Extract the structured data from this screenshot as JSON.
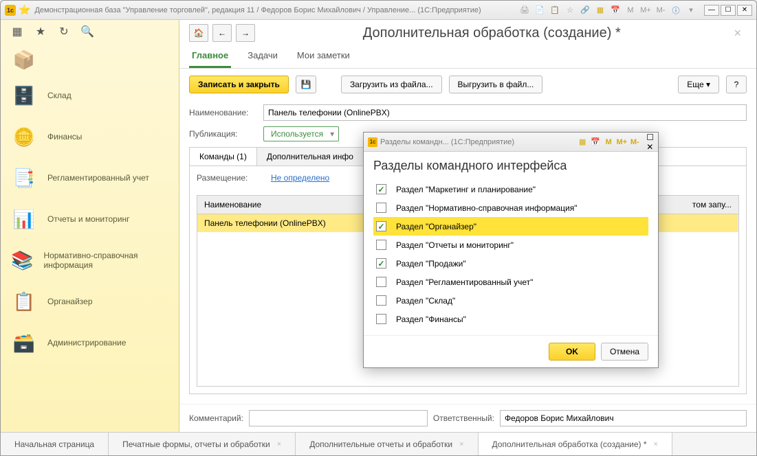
{
  "titlebar": {
    "title": "Демонстрационная база \"Управление торговлей\", редакция 11 / Федоров Борис Михайлович / Управление...  (1С:Предприятие)"
  },
  "sidebar": {
    "items": [
      {
        "label": "Склад"
      },
      {
        "label": "Финансы"
      },
      {
        "label": "Регламентированный учет"
      },
      {
        "label": "Отчеты и мониторинг"
      },
      {
        "label": "Нормативно-справочная информация"
      },
      {
        "label": "Органайзер"
      },
      {
        "label": "Администрирование"
      }
    ]
  },
  "page": {
    "title": "Дополнительная обработка (создание) *",
    "tabs": {
      "main": "Главное",
      "tasks": "Задачи",
      "notes": "Мои заметки"
    },
    "actions": {
      "save_close": "Записать и закрыть",
      "load_file": "Загрузить из файла...",
      "export_file": "Выгрузить в файл...",
      "more": "Еще"
    },
    "form": {
      "name_label": "Наименование:",
      "name_value": "Панель телефонии (OnlinePBX)",
      "pub_label": "Публикация:",
      "pub_value": "Используется",
      "inner_tabs": {
        "commands": "Команды (1)",
        "info": "Дополнительная инфо"
      },
      "placement_label": "Размещение:",
      "placement_value": "Не определено",
      "grid_col1": "Наименование",
      "grid_row1": "Панель телефонии (OnlinePBX)",
      "grid_col2_hint": "том запу..."
    },
    "footer": {
      "comment_label": "Комментарий:",
      "resp_label": "Ответственный:",
      "resp_value": "Федоров Борис Михайлович"
    }
  },
  "bottom_tabs": [
    {
      "label": "Начальная страница"
    },
    {
      "label": "Печатные формы, отчеты и обработки"
    },
    {
      "label": "Дополнительные отчеты и обработки"
    },
    {
      "label": "Дополнительная обработка (создание) *"
    }
  ],
  "dialog": {
    "titlebar": "Разделы командн...  (1С:Предприятие)",
    "heading": "Разделы командного интерфейса",
    "items": [
      {
        "checked": true,
        "label": "Раздел \"Маркетинг и планирование\""
      },
      {
        "checked": false,
        "label": "Раздел \"Нормативно-справочная информация\""
      },
      {
        "checked": true,
        "label": "Раздел \"Органайзер\"",
        "selected": true
      },
      {
        "checked": false,
        "label": "Раздел \"Отчеты и мониторинг\""
      },
      {
        "checked": true,
        "label": "Раздел \"Продажи\""
      },
      {
        "checked": false,
        "label": "Раздел \"Регламентированный учет\""
      },
      {
        "checked": false,
        "label": "Раздел \"Склад\""
      },
      {
        "checked": false,
        "label": "Раздел \"Финансы\""
      }
    ],
    "ok": "OK",
    "cancel": "Отмена"
  }
}
